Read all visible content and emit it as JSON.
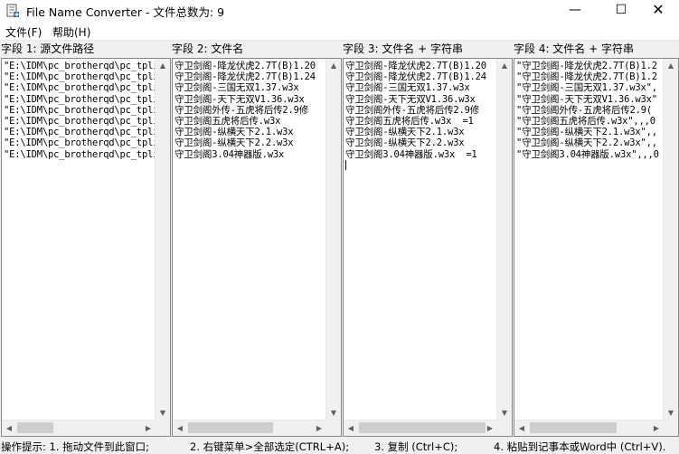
{
  "window": {
    "title": "File Name Converter - 文件总数为: 9",
    "minimize_glyph": "—",
    "maximize_glyph": "☐",
    "close_glyph": "✕"
  },
  "menu": {
    "items": [
      {
        "label": "文件(F)"
      },
      {
        "label": "帮助(H)"
      }
    ]
  },
  "columns": [
    {
      "header": "字段 1: 源文件路径",
      "lines": [
        "\"E:\\IDM\\pc_brotherqd\\pc_tpli",
        "\"E:\\IDM\\pc_brotherqd\\pc_tpli",
        "\"E:\\IDM\\pc_brotherqd\\pc_tpli",
        "\"E:\\IDM\\pc_brotherqd\\pc_tpli",
        "\"E:\\IDM\\pc_brotherqd\\pc_tpli",
        "\"E:\\IDM\\pc_brotherqd\\pc_tpli",
        "\"E:\\IDM\\pc_brotherqd\\pc_tpli",
        "\"E:\\IDM\\pc_brotherqd\\pc_tpli",
        "\"E:\\IDM\\pc_brotherqd\\pc_tpli"
      ]
    },
    {
      "header": "字段 2: 文件名",
      "lines": [
        "守卫剑阁-降龙伏虎2.7T(B)1.20",
        "守卫剑阁-降龙伏虎2.7T(B)1.24",
        "守卫剑阁-三国无双1.37.w3x",
        "守卫剑阁-天下无双V1.36.w3x",
        "守卫剑阁外传-五虎将后传2.9修",
        "守卫剑阁五虎将后传.w3x",
        "守卫剑阁-纵横天下2.1.w3x",
        "守卫剑阁-纵横天下2.2.w3x",
        "守卫剑阁3.04神器版.w3x"
      ]
    },
    {
      "header": "字段 3: 文件名  + 字符串",
      "lines": [
        "守卫剑阁-降龙伏虎2.7T(B)1.20",
        "守卫剑阁-降龙伏虎2.7T(B)1.24",
        "守卫剑阁-三国无双1.37.w3x",
        "守卫剑阁-天下无双V1.36.w3x",
        "守卫剑阁外传-五虎将后传2.9修",
        "守卫剑阁五虎将后传.w3x  =1",
        "守卫剑阁-纵横天下2.1.w3x",
        "守卫剑阁-纵横天下2.2.w3x",
        "守卫剑阁3.04神器版.w3x  =1"
      ]
    },
    {
      "header": "字段 4: 文件名 + 字符串",
      "lines": [
        "\"守卫剑阁-降龙伏虎2.7T(B)1.2",
        "\"守卫剑阁-降龙伏虎2.7T(B)1.2",
        "\"守卫剑阁-三国无双1.37.w3x\",",
        "\"守卫剑阁-天下无双V1.36.w3x\"",
        "\"守卫剑阁外传-五虎将后传2.9(",
        "\"守卫剑阁五虎将后传.w3x\",,,0",
        "\"守卫剑阁-纵横天下2.1.w3x\",,",
        "\"守卫剑阁-纵横天下2.2.w3x\",,",
        "\"守卫剑阁3.04神器版.w3x\",,,0"
      ]
    }
  ],
  "statusbar": {
    "parts": [
      "操作提示: 1. 拖动文件到此窗口;",
      "2. 右键菜单>全部选定(CTRL+A);",
      "3. 复制 (Ctrl+C);",
      "4. 粘贴到记事本或Word中 (Ctrl+V)."
    ]
  },
  "icons": {
    "app": "app-icon",
    "scroll_up": "arrow-up-icon",
    "scroll_down": "arrow-down-icon",
    "scroll_left": "arrow-left-icon",
    "scroll_right": "arrow-right-icon"
  },
  "colors": {
    "window_bg": "#f0f0f0",
    "pane_bg": "#ffffff",
    "pane_border": "#828790",
    "scroll_thumb": "#cdcdcd"
  }
}
